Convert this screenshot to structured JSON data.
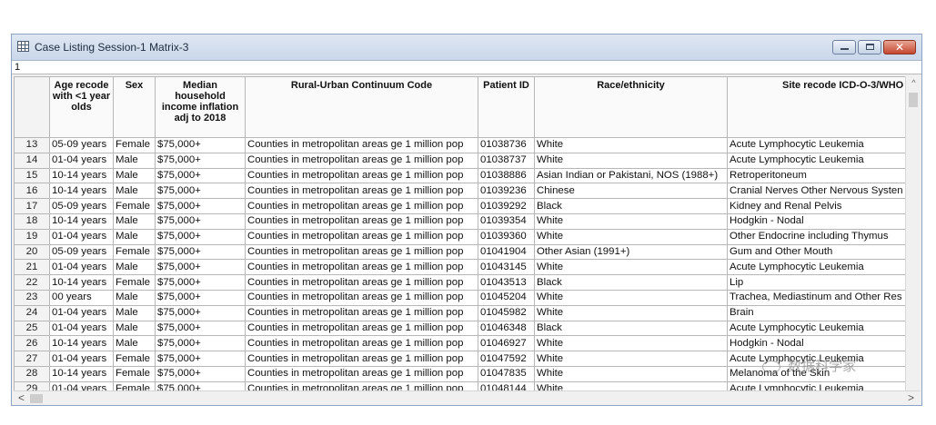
{
  "window": {
    "title": "Case Listing Session-1 Matrix-3",
    "cell_value": "1"
  },
  "icons": {
    "app": "grid-table-icon",
    "minimize": "minimize-icon",
    "maximize": "maximize-icon",
    "close": "close-icon",
    "scroll_up": "chevron-up-icon",
    "scroll_left": "chevron-left-icon",
    "scroll_right": "chevron-right-icon",
    "close_glyph": "✕",
    "up_glyph": "^",
    "left_glyph": "<",
    "right_glyph": ">"
  },
  "columns": [
    "Age recode with <1 year olds",
    "Sex",
    "Median household income inflation adj to 2018",
    "Rural-Urban Continuum Code",
    "Patient ID",
    "Race/ethnicity",
    "Site recode ICD-O-3/WHO"
  ],
  "rows": [
    {
      "n": "13",
      "age": "05-09 years",
      "sex": "Female",
      "income": "$75,000+",
      "ruc": "Counties in metropolitan areas ge 1 million pop",
      "pid": "01038736",
      "race": "White",
      "site": "Acute Lymphocytic Leukemia"
    },
    {
      "n": "14",
      "age": "01-04 years",
      "sex": "Male",
      "income": "$75,000+",
      "ruc": "Counties in metropolitan areas ge 1 million pop",
      "pid": "01038737",
      "race": "White",
      "site": "Acute Lymphocytic Leukemia"
    },
    {
      "n": "15",
      "age": "10-14 years",
      "sex": "Male",
      "income": "$75,000+",
      "ruc": "Counties in metropolitan areas ge 1 million pop",
      "pid": "01038886",
      "race": "Asian Indian or Pakistani, NOS (1988+)",
      "site": "Retroperitoneum"
    },
    {
      "n": "16",
      "age": "10-14 years",
      "sex": "Male",
      "income": "$75,000+",
      "ruc": "Counties in metropolitan areas ge 1 million pop",
      "pid": "01039236",
      "race": "Chinese",
      "site": "Cranial Nerves Other Nervous Systen"
    },
    {
      "n": "17",
      "age": "05-09 years",
      "sex": "Female",
      "income": "$75,000+",
      "ruc": "Counties in metropolitan areas ge 1 million pop",
      "pid": "01039292",
      "race": "Black",
      "site": "Kidney and Renal Pelvis"
    },
    {
      "n": "18",
      "age": "10-14 years",
      "sex": "Male",
      "income": "$75,000+",
      "ruc": "Counties in metropolitan areas ge 1 million pop",
      "pid": "01039354",
      "race": "White",
      "site": "Hodgkin - Nodal"
    },
    {
      "n": "19",
      "age": "01-04 years",
      "sex": "Male",
      "income": "$75,000+",
      "ruc": "Counties in metropolitan areas ge 1 million pop",
      "pid": "01039360",
      "race": "White",
      "site": "Other Endocrine including Thymus"
    },
    {
      "n": "20",
      "age": "05-09 years",
      "sex": "Female",
      "income": "$75,000+",
      "ruc": "Counties in metropolitan areas ge 1 million pop",
      "pid": "01041904",
      "race": "Other Asian (1991+)",
      "site": "Gum and Other Mouth"
    },
    {
      "n": "21",
      "age": "01-04 years",
      "sex": "Male",
      "income": "$75,000+",
      "ruc": "Counties in metropolitan areas ge 1 million pop",
      "pid": "01043145",
      "race": "White",
      "site": "Acute Lymphocytic Leukemia"
    },
    {
      "n": "22",
      "age": "10-14 years",
      "sex": "Female",
      "income": "$75,000+",
      "ruc": "Counties in metropolitan areas ge 1 million pop",
      "pid": "01043513",
      "race": "Black",
      "site": "Lip"
    },
    {
      "n": "23",
      "age": "00 years",
      "sex": "Male",
      "income": "$75,000+",
      "ruc": "Counties in metropolitan areas ge 1 million pop",
      "pid": "01045204",
      "race": "White",
      "site": "Trachea, Mediastinum and Other Res"
    },
    {
      "n": "24",
      "age": "01-04 years",
      "sex": "Male",
      "income": "$75,000+",
      "ruc": "Counties in metropolitan areas ge 1 million pop",
      "pid": "01045982",
      "race": "White",
      "site": "Brain"
    },
    {
      "n": "25",
      "age": "01-04 years",
      "sex": "Male",
      "income": "$75,000+",
      "ruc": "Counties in metropolitan areas ge 1 million pop",
      "pid": "01046348",
      "race": "Black",
      "site": "Acute Lymphocytic Leukemia"
    },
    {
      "n": "26",
      "age": "10-14 years",
      "sex": "Male",
      "income": "$75,000+",
      "ruc": "Counties in metropolitan areas ge 1 million pop",
      "pid": "01046927",
      "race": "White",
      "site": "Hodgkin - Nodal"
    },
    {
      "n": "27",
      "age": "01-04 years",
      "sex": "Female",
      "income": "$75,000+",
      "ruc": "Counties in metropolitan areas ge 1 million pop",
      "pid": "01047592",
      "race": "White",
      "site": "Acute Lymphocytic Leukemia"
    },
    {
      "n": "28",
      "age": "10-14 years",
      "sex": "Female",
      "income": "$75,000+",
      "ruc": "Counties in metropolitan areas ge 1 million pop",
      "pid": "01047835",
      "race": "White",
      "site": "Melanoma of the Skin"
    },
    {
      "n": "29",
      "age": "01-04 years",
      "sex": "Female",
      "income": "$75,000+",
      "ruc": "Counties in metropolitan areas ge 1 million pop",
      "pid": "01048144",
      "race": "White",
      "site": "Acute Lymphocytic Leukemia"
    }
  ],
  "watermark": {
    "text": "数据科学家"
  }
}
